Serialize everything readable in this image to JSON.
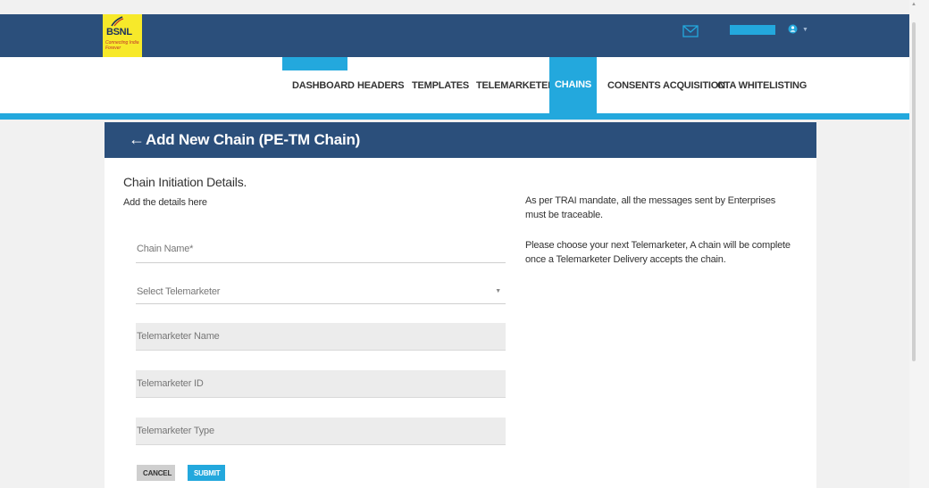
{
  "brand": {
    "name": "BSNL",
    "tagline": "Connecting India Forever"
  },
  "nav": {
    "items": [
      {
        "label": "DASHBOARD"
      },
      {
        "label": "HEADERS"
      },
      {
        "label": "TEMPLATES"
      },
      {
        "label": "TELEMARKETERS"
      },
      {
        "label": "CHAINS",
        "active": true
      },
      {
        "label": "CONSENTS ACQUISITION"
      },
      {
        "label": "CTA WHITELISTING"
      }
    ]
  },
  "header_icons": [
    "mail-icon",
    "user-icon",
    "caret-down-icon"
  ],
  "page": {
    "title": "Add New Chain (PE-TM Chain)",
    "back_icon": "arrow-left-icon"
  },
  "form": {
    "section_title": "Chain Initiation Details.",
    "section_subtitle": "Add the details here",
    "chain_name_placeholder": "Chain Name*",
    "telemarketer_select_placeholder": "Select Telemarketer",
    "telemarketer_name_placeholder": "Telemarketer Name",
    "telemarketer_id_placeholder": "Telemarketer ID",
    "telemarketer_type_placeholder": "Telemarketer Type",
    "cancel_label": "CANCEL",
    "submit_label": "SUBMIT"
  },
  "info": {
    "paragraph1": "As per TRAI mandate, all the messages sent by Enterprises must be traceable.",
    "paragraph2": "Please choose your next Telemarketer, A chain will be complete once a Telemarketer Delivery accepts the chain."
  },
  "colors": {
    "header_bg": "#2b4f7b",
    "accent": "#23a8dd",
    "logo_bg": "#f7e92a"
  }
}
